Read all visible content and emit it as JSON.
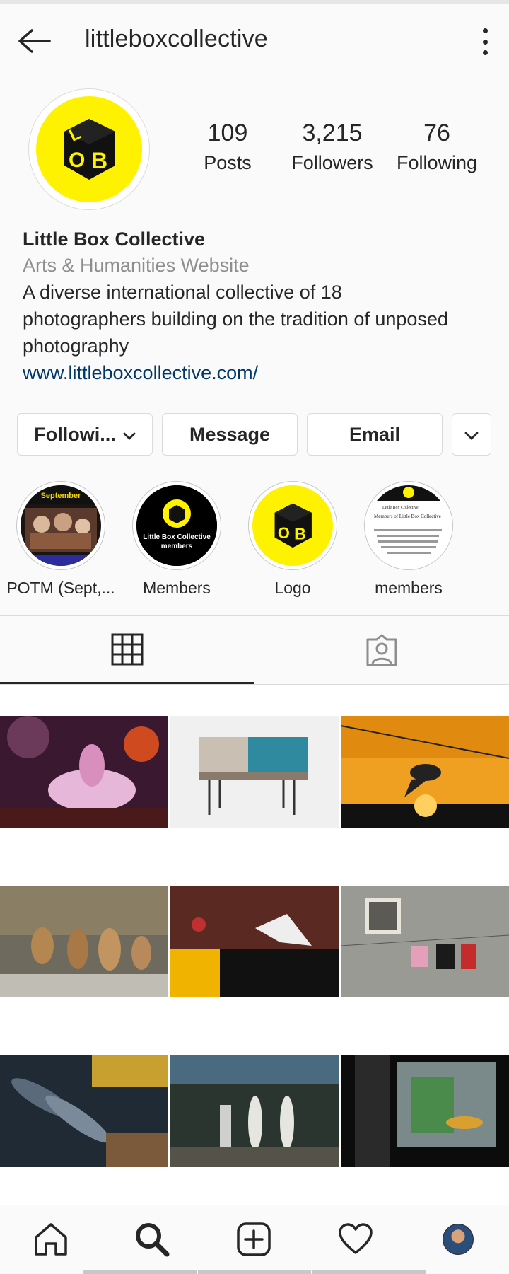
{
  "header": {
    "username": "littleboxcollective"
  },
  "profile": {
    "stats": [
      {
        "value": "109",
        "label": "Posts"
      },
      {
        "value": "3,215",
        "label": "Followers"
      },
      {
        "value": "76",
        "label": "Following"
      }
    ],
    "name": "Little Box Collective",
    "category": "Arts & Humanities Website",
    "bio_lines": [
      "A diverse international collective of 18",
      "photographers building on the tradition of unposed",
      "photography"
    ],
    "website": "www.littleboxcollective.com/"
  },
  "actions": {
    "following_label": "Followi...",
    "message_label": "Message",
    "email_label": "Email"
  },
  "highlights": [
    {
      "label": "POTM (Sept,...",
      "badge": "September"
    },
    {
      "label": "Members",
      "badge_line1": "Little Box Collective",
      "badge_line2": "members"
    },
    {
      "label": "Logo"
    },
    {
      "label": "members",
      "doc_title": "Little Box Collective",
      "doc_heading": "Members of Little Box Collective"
    }
  ],
  "tabs": [
    "grid-icon",
    "tagged-icon"
  ],
  "nav": [
    "home-icon",
    "search-icon",
    "add-post-icon",
    "heart-icon",
    "profile-avatar"
  ],
  "colors": {
    "brand_yellow": "#fff200",
    "link": "#00376b",
    "secondary_text": "#8e8e8e"
  }
}
